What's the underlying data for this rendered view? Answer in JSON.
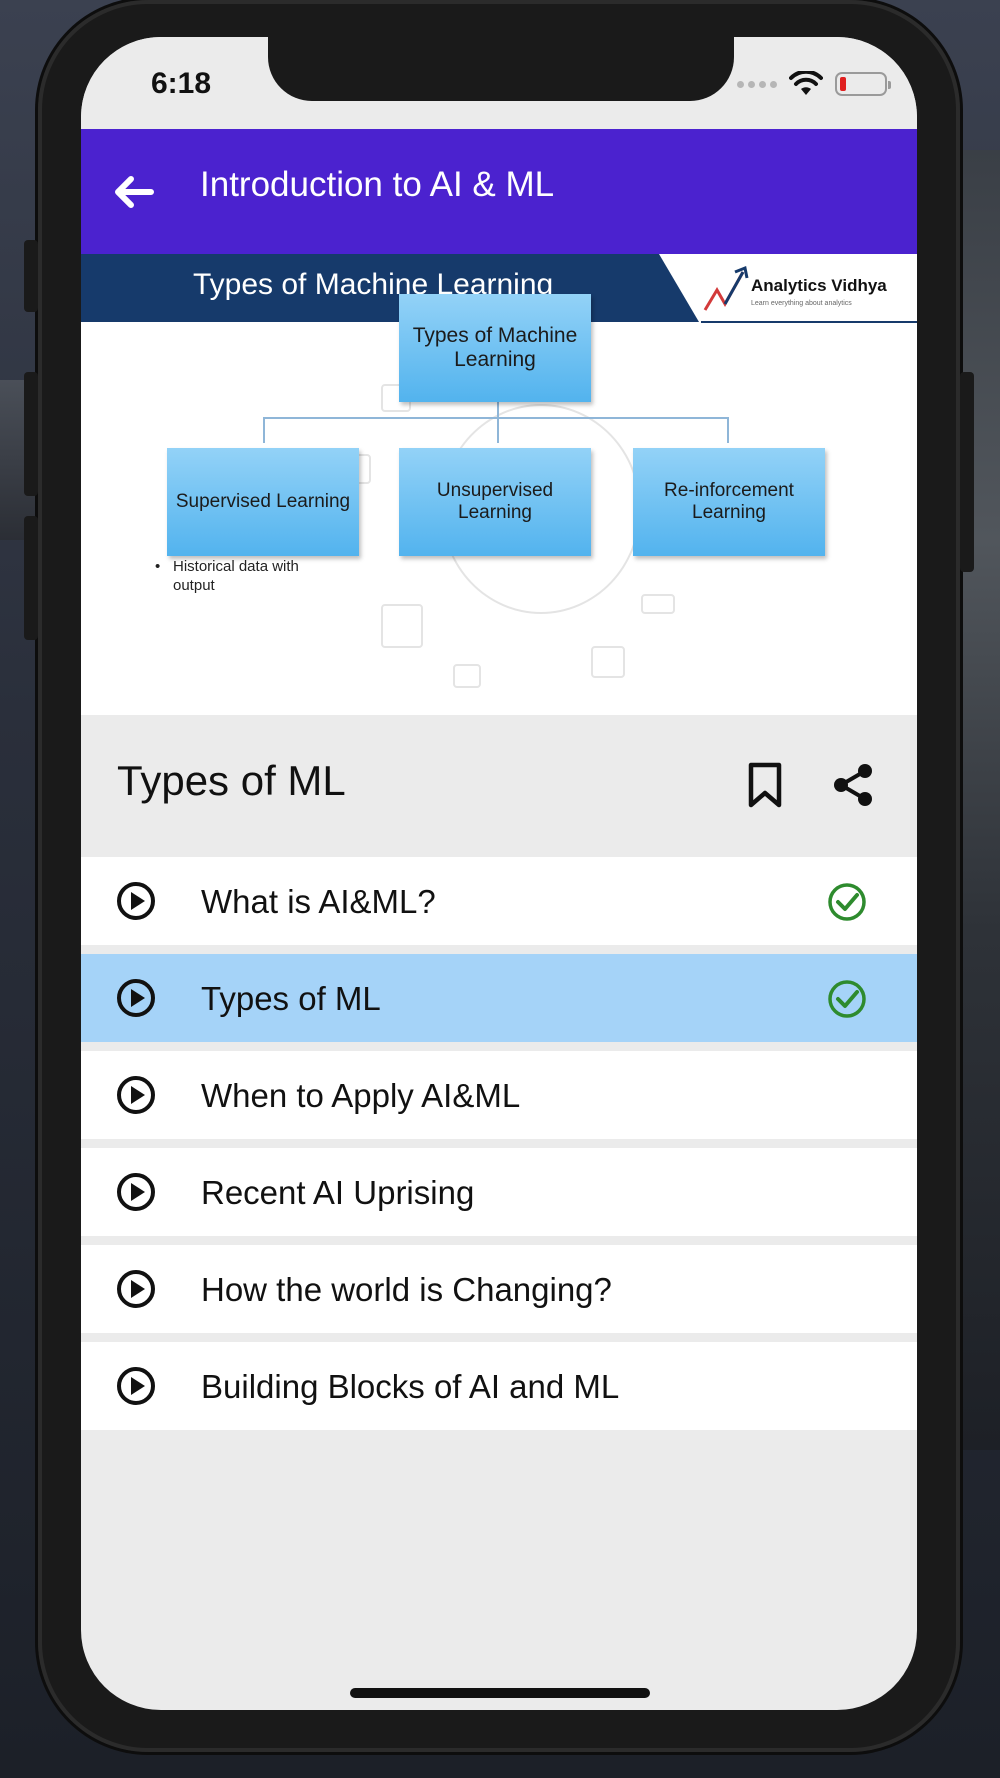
{
  "status_bar": {
    "time": "6:18"
  },
  "header": {
    "title": "Introduction to AI & ML",
    "back_icon": "arrow-left-icon"
  },
  "slide": {
    "band_title": "Types of Machine Learning",
    "logo_name": "Analytics Vidhya",
    "logo_tagline": "Learn everything about analytics",
    "root_box": "Types of Machine Learning",
    "child_boxes": [
      "Supervised Learning",
      "Unsupervised Learning",
      "Re-inforcement Learning"
    ],
    "bullet": "Historical data with output"
  },
  "lesson": {
    "title": "Types of ML",
    "bookmark_icon": "bookmark-icon",
    "share_icon": "share-icon"
  },
  "lessons": [
    {
      "label": "What is AI&ML?",
      "completed": true,
      "active": false
    },
    {
      "label": "Types of ML",
      "completed": true,
      "active": true
    },
    {
      "label": "When to Apply AI&ML",
      "completed": false,
      "active": false
    },
    {
      "label": "Recent AI Uprising",
      "completed": false,
      "active": false
    },
    {
      "label": "How the world is Changing?",
      "completed": false,
      "active": false
    },
    {
      "label": "Building Blocks of AI and ML",
      "completed": false,
      "active": false
    }
  ],
  "colors": {
    "header_bg": "#4b22cf",
    "active_row": "#a5d3f8",
    "check_green": "#2e8b2e",
    "slide_band": "#163a6b"
  }
}
